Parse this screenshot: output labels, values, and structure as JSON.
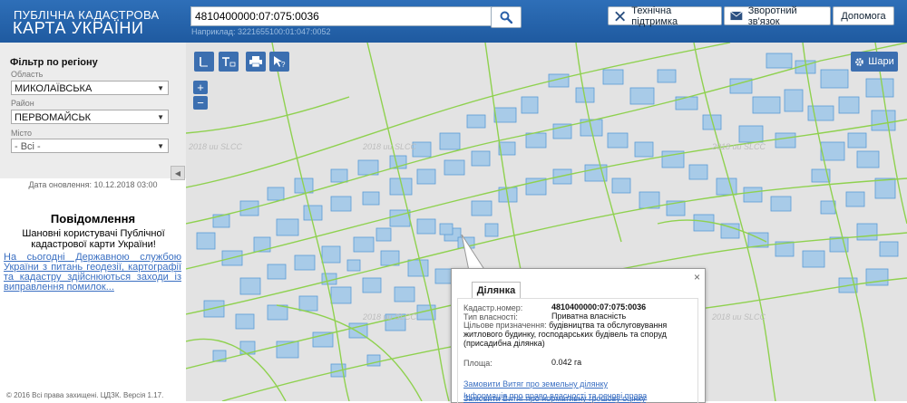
{
  "header": {
    "logo_line1": "ПУБЛІЧНА КАДАСТРОВА",
    "logo_line2": "КАРТА УКРАЇНИ",
    "search_value": "4810400000:07:075:0036",
    "search_hint": "Наприклад: 3221655100:01:047:0052",
    "buttons": {
      "support": "Технічна підтримка",
      "feedback": "Зворотний зв'язок",
      "help": "Допомога"
    }
  },
  "filter": {
    "title": "Фільтр по регіону",
    "region_label": "Область",
    "region_value": "МИКОЛАЇВСЬКА",
    "district_label": "Район",
    "district_value": "ПЕРВОМАЙСЬК",
    "city_label": "Місто",
    "city_value": "- Всі -",
    "collapse_glyph": "◀"
  },
  "updated": "Дата оновлення: 10.12.2018 03:00",
  "notice": {
    "title": "Повідомлення",
    "text": "Шановні користувачі Публічної кадастрової карти України!",
    "link": "На сьогодні Державною службою України з питань геодезії, картографії та кадастру здійснюються заходи із виправлення помилок..."
  },
  "copyright": "© 2016 Всі права захищені. ЦДЗК. Версія 1.17.",
  "map": {
    "zoom_in": "+",
    "zoom_out": "−",
    "layers_label": "Шари",
    "watermark": "2018 ии SLCC",
    "colors": {
      "background": "#e3e3e3",
      "parcel_fill": "#a8cbe8",
      "parcel_stroke": "#5b9bd5",
      "boundary": "#8fd14f"
    }
  },
  "popup": {
    "close": "×",
    "tab": "Ділянка",
    "cadnum_label": "Кадастр.номер:",
    "cadnum_value": "4810400000:07:075:0036",
    "ownership_label": "Тип власності:",
    "ownership_value": "Приватна власність",
    "purpose_label": "Цільове призначення:",
    "purpose_value": "будівництва та обслуговування житлового будинку, господарських будівель та споруд (присадибна ділянка)",
    "area_label": "Площа:",
    "area_value": "0.042 га",
    "links": [
      "Замовити Витяг про земельну ділянку",
      "Замовити Витяг про нормативну грошову оцінку",
      "Інформація про право власності та речові права"
    ]
  }
}
